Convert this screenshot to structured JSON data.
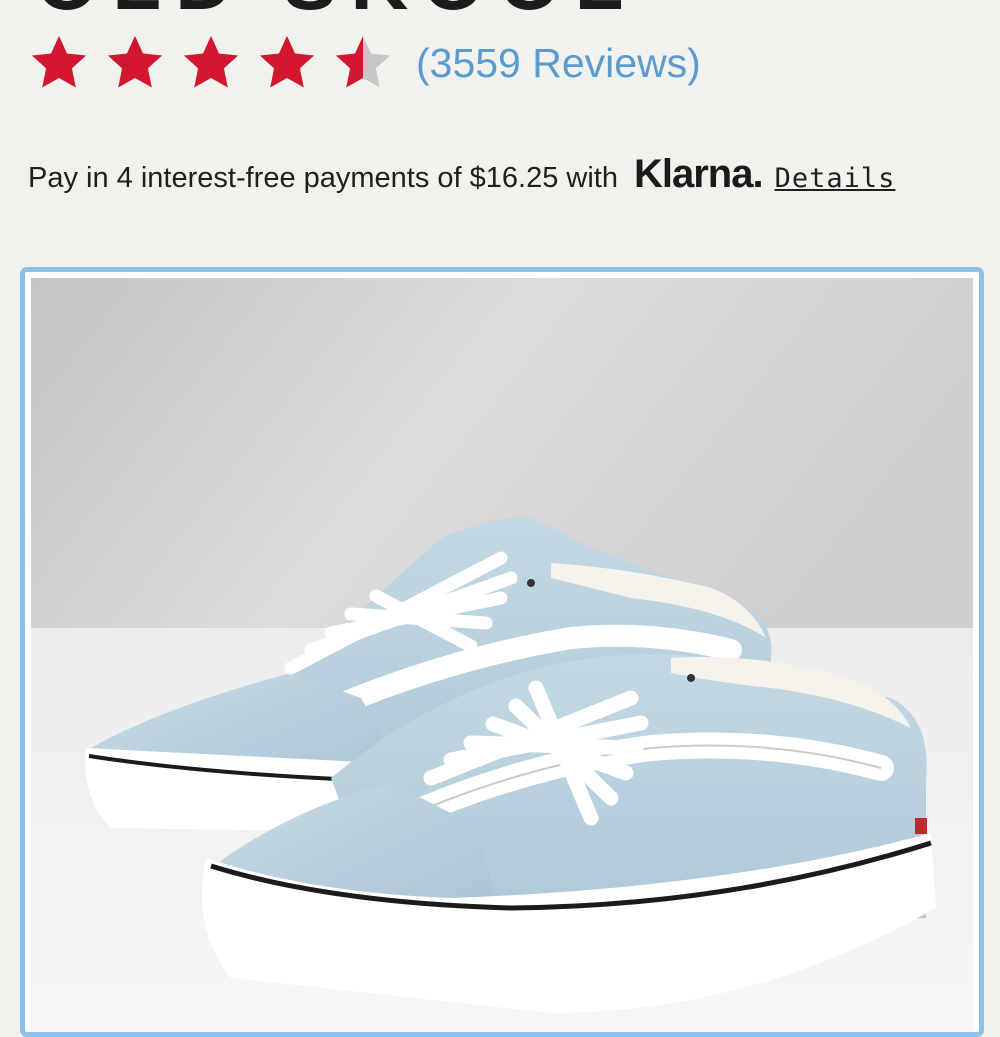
{
  "product": {
    "title_fragment": "OLD SKOOL",
    "rating": {
      "value": 4.5,
      "max": 5
    },
    "reviews_label": "(3559 Reviews)",
    "payment": {
      "text": "Pay in 4 interest-free payments of $16.25 with",
      "provider": "Klarna.",
      "details_label": "Details"
    },
    "image": {
      "subject": "light blue suede and canvas low-top sneakers with white side stripe"
    }
  },
  "colors": {
    "page_bg": "#f1f2ee",
    "star_filled": "#d3162f",
    "star_empty": "#c8c8c8",
    "link": "#5a9bd2",
    "image_border": "#8ec1ea"
  }
}
